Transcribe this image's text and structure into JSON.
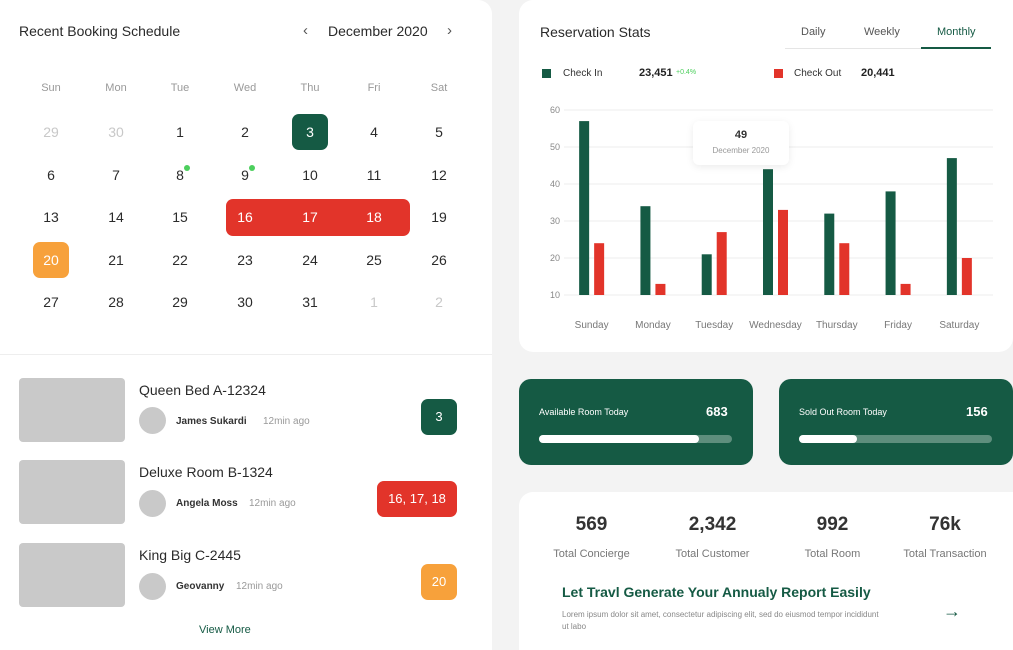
{
  "calendar": {
    "title": "Recent Booking Schedule",
    "month": "December 2020",
    "prev_icon": "chevron-left-icon",
    "next_icon": "chevron-right-icon",
    "weekdays": [
      "Sun",
      "Mon",
      "Tue",
      "Wed",
      "Thu",
      "Fri",
      "Sat"
    ],
    "weeks": [
      [
        "29",
        "30",
        "1",
        "2",
        "3",
        "4",
        "5"
      ],
      [
        "6",
        "7",
        "8",
        "9",
        "10",
        "11",
        "12"
      ],
      [
        "13",
        "14",
        "15",
        "16",
        "17",
        "18",
        "19"
      ],
      [
        "20",
        "21",
        "22",
        "23",
        "24",
        "25",
        "26"
      ],
      [
        "27",
        "28",
        "29",
        "30",
        "31",
        "1",
        "2"
      ]
    ]
  },
  "bookings": [
    {
      "room": "Queen Bed A-12324",
      "guest": "James Sukardi",
      "ago": "12min ago",
      "badge": "3",
      "badge_color": "#155a44"
    },
    {
      "room": "Deluxe Room B-1324",
      "guest": "Angela Moss",
      "ago": "12min ago",
      "badge": "16, 17, 18",
      "badge_color": "#e2342a"
    },
    {
      "room": "King Big C-2445",
      "guest": "Geovanny",
      "ago": "12min ago",
      "badge": "20",
      "badge_color": "#f7a13b"
    }
  ],
  "view_more": "View More",
  "stats": {
    "title": "Reservation Stats",
    "tabs": [
      "Daily",
      "Weekly",
      "Monthly"
    ],
    "active_tab": "Monthly",
    "checkin_label": "Check In",
    "checkin_value": "23,451",
    "checkin_delta": "+0.4%",
    "checkout_label": "Check Out",
    "checkout_value": "20,441",
    "tooltip_value": "49",
    "tooltip_date": "December 2020"
  },
  "chart_data": {
    "type": "bar",
    "categories": [
      "Sunday",
      "Monday",
      "Tuesday",
      "Wednesday",
      "Thursday",
      "Friday",
      "Saturday"
    ],
    "series": [
      {
        "name": "Check In",
        "color": "#155a44",
        "values": [
          57,
          34,
          21,
          44,
          32,
          38,
          47
        ]
      },
      {
        "name": "Check Out",
        "color": "#e2342a",
        "values": [
          24,
          13,
          27,
          33,
          24,
          13,
          20
        ]
      }
    ],
    "yticks": [
      10,
      20,
      30,
      40,
      50,
      60
    ],
    "ylim": [
      10,
      60
    ],
    "grid": true
  },
  "rooms": {
    "available_label": "Available Room Today",
    "available_value": "683",
    "available_progress": 0.83,
    "soldout_label": "Sold Out Room Today",
    "soldout_value": "156",
    "soldout_progress": 0.3
  },
  "totals": [
    {
      "value": "569",
      "label": "Total Concierge"
    },
    {
      "value": "2,342",
      "label": "Total Customer"
    },
    {
      "value": "992",
      "label": "Total Room"
    },
    {
      "value": "76k",
      "label": "Total Transaction"
    }
  ],
  "report": {
    "title": "Let Travl Generate Your Annualy Report Easily",
    "text": "Lorem ipsum dolor sit amet, consectetur adipiscing elit, sed do eiusmod tempor incididunt ut labo",
    "arrow_icon": "arrow-right-icon"
  }
}
